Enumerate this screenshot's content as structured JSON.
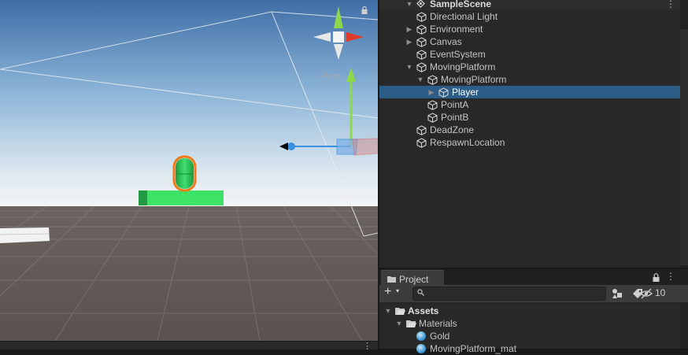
{
  "scene_view": {
    "persp_label": "Pers",
    "gizmo_axis_y": "y",
    "icons": [
      "lock-icon",
      "scene-gizmo-icon",
      "move-tool-icon",
      "menu-dots-icon"
    ]
  },
  "hierarchy": {
    "scene_name": "SampleScene",
    "menu_dots": "⋮",
    "items": [
      {
        "label": "Directional Light",
        "expandable": false,
        "selected": false
      },
      {
        "label": "Environment",
        "expandable": true,
        "expanded": false,
        "selected": false
      },
      {
        "label": "Canvas",
        "expandable": true,
        "expanded": false,
        "selected": false
      },
      {
        "label": "EventSystem",
        "expandable": false,
        "selected": false
      },
      {
        "label": "MovingPlatform",
        "expandable": true,
        "expanded": true,
        "selected": false
      },
      {
        "label": "MovingPlatform",
        "expandable": true,
        "expanded": true,
        "selected": false
      },
      {
        "label": "Player",
        "expandable": true,
        "expanded": false,
        "selected": true
      },
      {
        "label": "PointA",
        "expandable": false,
        "selected": false
      },
      {
        "label": "PointB",
        "expandable": false,
        "selected": false
      },
      {
        "label": "DeadZone",
        "expandable": false,
        "selected": false
      },
      {
        "label": "RespawnLocation",
        "expandable": false,
        "selected": false
      }
    ]
  },
  "project": {
    "tab_label": "Project",
    "menu_dots": "⋮",
    "add_plus": "+",
    "add_caret": "▾",
    "search_value": "",
    "search_placeholder": "",
    "hidden_count": "10",
    "tree": [
      {
        "label": "Assets",
        "kind": "folder",
        "bold": true
      },
      {
        "label": "Materials",
        "kind": "folder",
        "bold": false
      },
      {
        "label": "Gold",
        "kind": "material",
        "bold": false
      },
      {
        "label": "MovingPlatform_mat",
        "kind": "material",
        "bold": false
      }
    ],
    "icons": [
      "folder-icon",
      "lock-icon",
      "search-icon",
      "filter-by-type-icon",
      "label-icon",
      "hidden-visibility-icon"
    ]
  },
  "colors": {
    "selection": "#2c5d87",
    "panel_bg": "#282828",
    "platform_green": "#2ed35a",
    "player_outline": "#f07a1a",
    "gizmo_x": "#e03a2a",
    "gizmo_y": "#8fd84b",
    "gizmo_z": "#3a8fe0"
  }
}
